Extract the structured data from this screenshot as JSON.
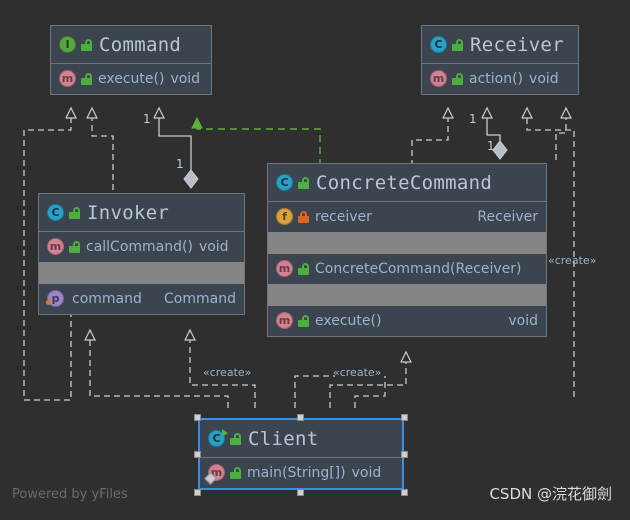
{
  "diagram": {
    "title": "Command Pattern UML Class Diagram",
    "background_color": "#2f2f2f",
    "box_fill": "#3c4450",
    "box_border": "#6d7680",
    "separator_fill": "#858585",
    "selection_color": "#3a8fe0",
    "realization_color": "#5cb03c",
    "edge_color": "#c8cdd3"
  },
  "classes": {
    "command": {
      "name": "Command",
      "kind_icon": "interface-icon",
      "kind_letter": "I",
      "visibility_icon": "unlock-icon",
      "members": [
        {
          "icon": "method-icon",
          "icon_letter": "m",
          "lock": "unlock-icon",
          "name": "execute()",
          "type": "void"
        }
      ]
    },
    "receiver": {
      "name": "Receiver",
      "kind_icon": "class-icon",
      "kind_letter": "C",
      "visibility_icon": "unlock-icon",
      "members": [
        {
          "icon": "method-icon",
          "icon_letter": "m",
          "lock": "unlock-icon",
          "name": "action()",
          "type": "void"
        }
      ]
    },
    "invoker": {
      "name": "Invoker",
      "kind_icon": "class-icon",
      "kind_letter": "C",
      "visibility_icon": "unlock-icon",
      "members": [
        {
          "icon": "method-icon",
          "icon_letter": "m",
          "lock": "unlock-icon",
          "name": "callCommand()",
          "type": "void"
        },
        {
          "icon": "property-icon",
          "icon_letter": "p",
          "lock": "none",
          "name": "command",
          "type": "Command"
        }
      ]
    },
    "concrete_command": {
      "name": "ConcreteCommand",
      "kind_icon": "class-icon",
      "kind_letter": "C",
      "visibility_icon": "unlock-icon",
      "members": [
        {
          "icon": "field-icon",
          "icon_letter": "f",
          "lock": "lock-icon",
          "name": "receiver",
          "type": "Receiver"
        },
        {
          "icon": "method-icon",
          "icon_letter": "m",
          "lock": "unlock-icon",
          "name": "ConcreteCommand(Receiver)",
          "type": ""
        },
        {
          "icon": "method-icon",
          "icon_letter": "m",
          "lock": "unlock-icon",
          "name": "execute()",
          "type": "void"
        }
      ]
    },
    "client": {
      "name": "Client",
      "kind_icon": "class-icon",
      "kind_letter": "C",
      "visibility_icon": "unlock-icon",
      "selected": true,
      "members": [
        {
          "icon": "static-method-icon",
          "icon_letter": "m",
          "lock": "unlock-icon",
          "name": "main(String[])",
          "type": "void"
        }
      ]
    }
  },
  "edge_labels": {
    "create_left": "«create»",
    "create_mid": "«create»",
    "create_right": "«create»",
    "mult_invoker_command": "1",
    "mult_invoker_command_near": "1",
    "mult_cc_receiver": "1",
    "mult_cc_receiver_near": "1"
  },
  "watermarks": {
    "left": "Powered by yFiles",
    "right": "CSDN @浣花御劍"
  }
}
